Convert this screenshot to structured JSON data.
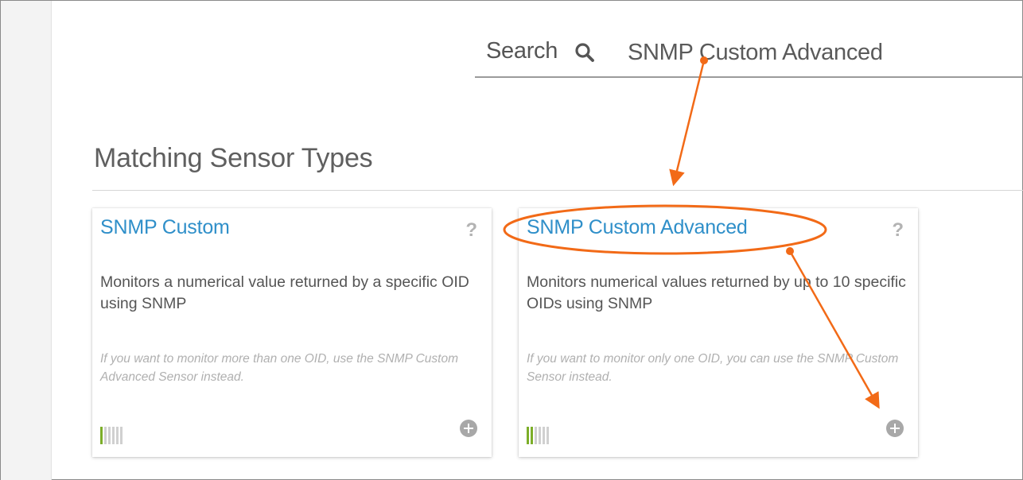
{
  "search": {
    "label": "Search",
    "icon": "search-icon",
    "value": "SNMP Custom Advanced"
  },
  "section": {
    "title": "Matching Sensor Types"
  },
  "cards": [
    {
      "title": "SNMP Custom",
      "help": "?",
      "description": "Monitors a numerical value returned by a specific OID using SNMP",
      "note": "If you want to monitor more than one OID, use the SNMP Custom Advanced Sensor instead.",
      "level": 1,
      "level_max": 6
    },
    {
      "title": "SNMP Custom Advanced",
      "help": "?",
      "description": "Monitors numerical values returned by up to 10 specific OIDs using SNMP",
      "note": "If you want to monitor only one OID, you can use the SNMP Custom Sensor instead.",
      "level": 2,
      "level_max": 6
    }
  ],
  "colors": {
    "accent": "#2f8fc9",
    "annotation": "#f26a17",
    "level_on": "#7cae29",
    "level_off": "#d0d0d0"
  }
}
